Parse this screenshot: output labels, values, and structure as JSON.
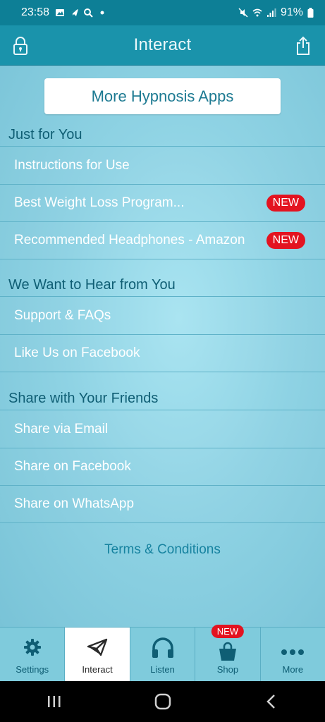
{
  "status_bar": {
    "time": "23:58",
    "battery": "91%"
  },
  "header": {
    "title": "Interact"
  },
  "more_apps_button": "More Hypnosis Apps",
  "sections": [
    {
      "title": "Just for You",
      "items": [
        {
          "label": "Instructions for Use"
        },
        {
          "label": "Best Weight Loss Program...",
          "badge": "NEW"
        },
        {
          "label": "Recommended Headphones - Amazon",
          "badge": "NEW"
        }
      ]
    },
    {
      "title": "We Want to Hear from You",
      "items": [
        {
          "label": "Support & FAQs"
        },
        {
          "label": "Like Us on Facebook"
        }
      ]
    },
    {
      "title": "Share with Your Friends",
      "items": [
        {
          "label": "Share via Email"
        },
        {
          "label": "Share on Facebook"
        },
        {
          "label": "Share on WhatsApp"
        }
      ]
    }
  ],
  "terms_link": "Terms & Conditions",
  "tabs": [
    {
      "label": "Settings",
      "icon": "gear-icon"
    },
    {
      "label": "Interact",
      "icon": "paper-plane-icon",
      "active": true
    },
    {
      "label": "Listen",
      "icon": "headphones-icon"
    },
    {
      "label": "Shop",
      "icon": "shopping-bag-icon",
      "badge": "NEW"
    },
    {
      "label": "More",
      "icon": "more-dots-icon"
    }
  ],
  "colors": {
    "header_bg": "#1a93ab",
    "content_bg": "#8fd3e4",
    "badge_red": "#e31320"
  }
}
